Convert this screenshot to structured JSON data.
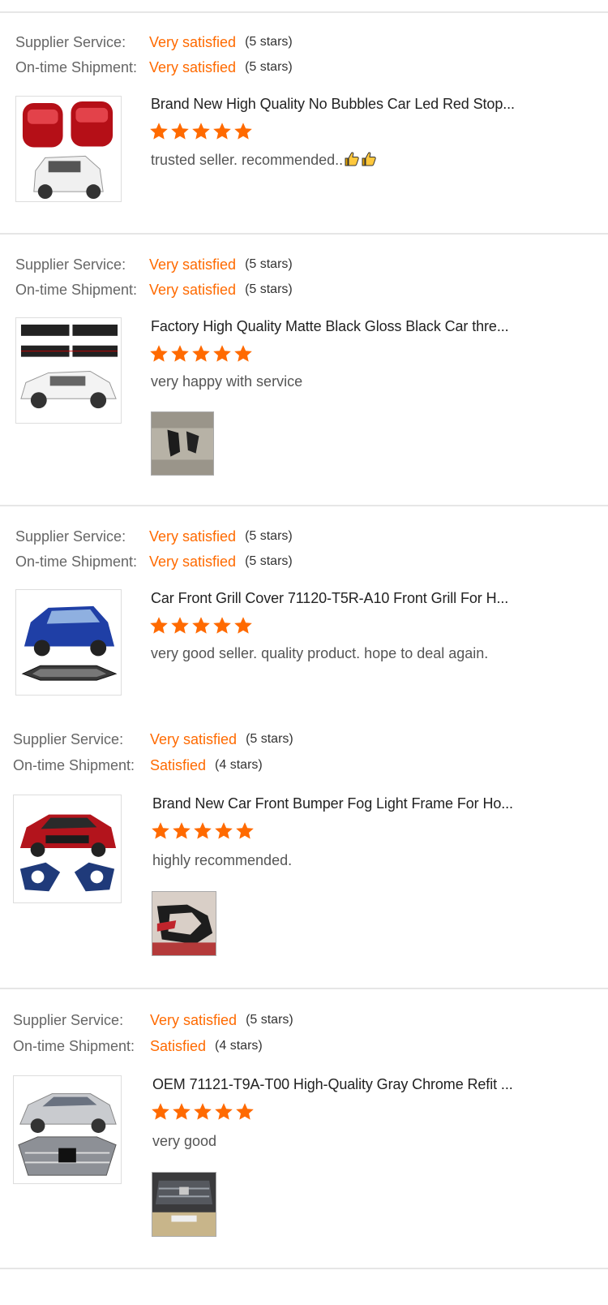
{
  "labels": {
    "supplier_service": "Supplier Service:",
    "ontime_shipment": "On-time Shipment:"
  },
  "accent_color": "#ff6a00",
  "reviews": [
    {
      "supplier_value": "Very satisfied",
      "supplier_stars": "(5 stars)",
      "shipment_value": "Very satisfied",
      "shipment_stars": "(5 stars)",
      "product_title": "Brand New High Quality No Bubbles Car Led Red Stop...",
      "rating": 5,
      "comment": "trusted seller. recommended..",
      "comment_emoji": [
        "thumbs-up-icon",
        "thumbs-up-icon"
      ],
      "thumbnail": "red-tail-lights-and-white-suv",
      "has_photo": false
    },
    {
      "supplier_value": "Very satisfied",
      "supplier_stars": "(5 stars)",
      "shipment_value": "Very satisfied",
      "shipment_stars": "(5 stars)",
      "product_title": "Factory High Quality Matte Black Gloss Black Car thre...",
      "rating": 5,
      "comment": "very happy with service",
      "thumbnail": "black-door-trims-and-white-suv",
      "has_photo": true
    },
    {
      "supplier_value": "Very satisfied",
      "supplier_stars": "(5 stars)",
      "shipment_value": "Very satisfied",
      "shipment_stars": "(5 stars)",
      "product_title": "Car Front Grill Cover 71120-T5R-A10 Front Grill For H...",
      "rating": 5,
      "comment": "very good seller. quality product. hope to deal again.",
      "thumbnail": "blue-hatchback-and-grill",
      "has_photo": false
    },
    {
      "supplier_value": "Very satisfied",
      "supplier_stars": "(5 stars)",
      "shipment_value": "Satisfied",
      "shipment_stars": "(4 stars)",
      "product_title": "Brand New Car Front Bumper Fog Light Frame For Ho...",
      "rating": 5,
      "comment": "highly recommended.",
      "thumbnail": "red-sedan-and-fog-light-frames",
      "has_photo": true
    },
    {
      "supplier_value": "Very satisfied",
      "supplier_stars": "(5 stars)",
      "shipment_value": "Satisfied",
      "shipment_stars": "(4 stars)",
      "product_title": "OEM 71121-T9A-T00 High-Quality Gray Chrome Refit ...",
      "rating": 5,
      "comment": "very good",
      "thumbnail": "silver-sedan-and-chrome-grill",
      "has_photo": true
    }
  ]
}
